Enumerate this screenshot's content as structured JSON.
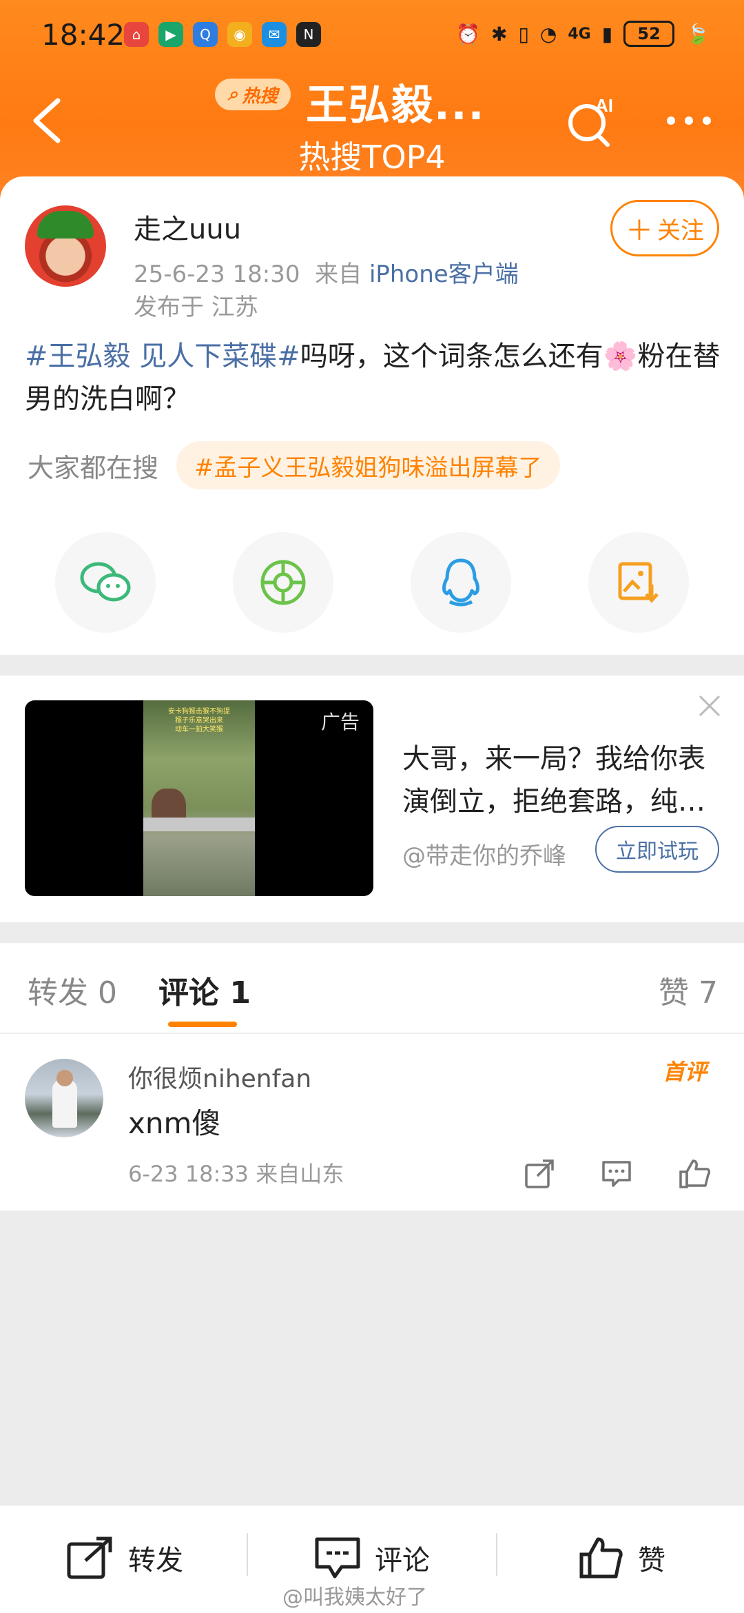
{
  "status_bar": {
    "time": "18:42",
    "battery": "52",
    "network": "4G"
  },
  "header": {
    "hot_badge": "热搜",
    "title": "王弘毅...",
    "subtitle": "热搜TOP4",
    "ai_label": "AI",
    "accent": "#ff7a12"
  },
  "post": {
    "username": "走之uuu",
    "time": "25-6-23 18:30",
    "from_prefix": "来自",
    "source": "iPhone客户端",
    "location": "发布于 江苏",
    "follow_label": "关注",
    "topic_tag": "#王弘毅 见人下菜碟#",
    "body": "吗呀，这个词条怎么还有🌸粉在替男的洗白啊？",
    "search_label": "大家都在搜",
    "search_pill": "#孟子义王弘毅姐狗味溢出屏幕了"
  },
  "share_icons": [
    "wechat-icon",
    "moments-icon",
    "qq-icon",
    "save-image-icon"
  ],
  "ad": {
    "tag": "广告",
    "text": "大哥，来一局？我给你表演倒立，拒绝套路，纯手法",
    "author": "@带走你的乔峰",
    "cta": "立即试玩"
  },
  "tabs": {
    "repost_label": "转发",
    "repost_count": "0",
    "comment_label": "评论",
    "comment_count": "1",
    "like_label": "赞",
    "like_count": "7"
  },
  "comment": {
    "name": "你很烦nihenfan",
    "badge": "首评",
    "text": "xnm傻",
    "meta": "6-23 18:33 来自山东"
  },
  "bottom_bar": {
    "repost": "转发",
    "comment": "评论",
    "like": "赞"
  },
  "watermark": "@叫我姨太好了"
}
